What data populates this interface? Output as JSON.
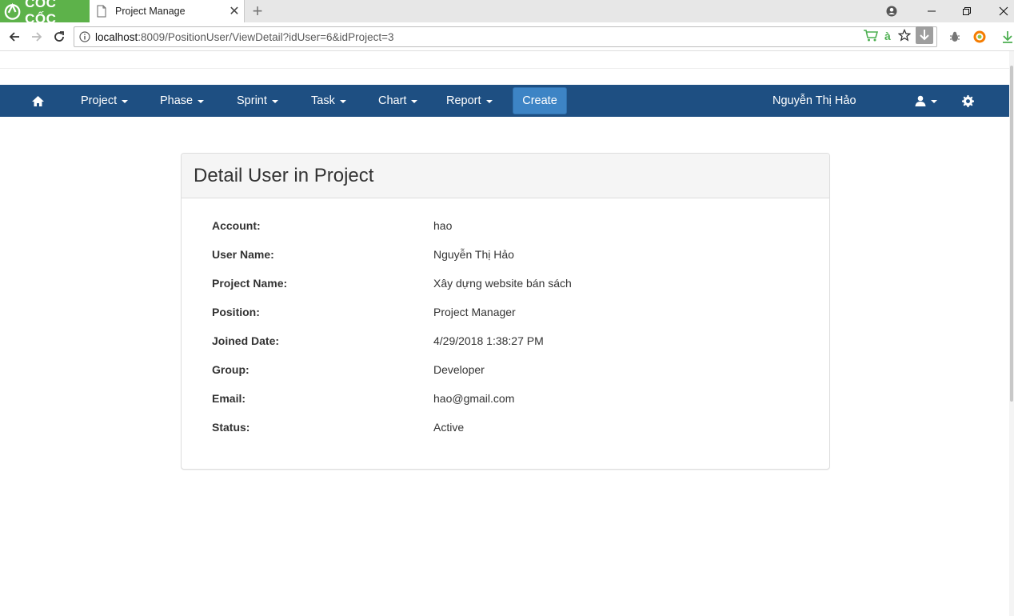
{
  "browser": {
    "brand": "CỐC CỐC",
    "tab_title": "Project Manage",
    "url_host": "localhost",
    "url_rest": ":8009/PositionUser/ViewDetail?idUser=6&idProject=3"
  },
  "nav": {
    "items": [
      {
        "label": "Project"
      },
      {
        "label": "Phase"
      },
      {
        "label": "Sprint"
      },
      {
        "label": "Task"
      },
      {
        "label": "Chart"
      },
      {
        "label": "Report"
      }
    ],
    "create_label": "Create",
    "user_name": "Nguyễn Thị Hảo"
  },
  "panel": {
    "title": "Detail User in Project",
    "rows": [
      {
        "label": "Account:",
        "value": "hao"
      },
      {
        "label": "User Name:",
        "value": "Nguyễn Thị Hảo"
      },
      {
        "label": "Project Name:",
        "value": "Xây dựng website bán sách"
      },
      {
        "label": "Position:",
        "value": "Project Manager"
      },
      {
        "label": "Joined Date:",
        "value": "4/29/2018 1:38:27 PM"
      },
      {
        "label": "Group:",
        "value": "Developer"
      },
      {
        "label": "Email:",
        "value": "hao@gmail.com"
      },
      {
        "label": "Status:",
        "value": "Active"
      }
    ]
  },
  "colors": {
    "navbar": "#1e4f82",
    "create_button": "#3d84c5",
    "brand": "#5db24a"
  }
}
